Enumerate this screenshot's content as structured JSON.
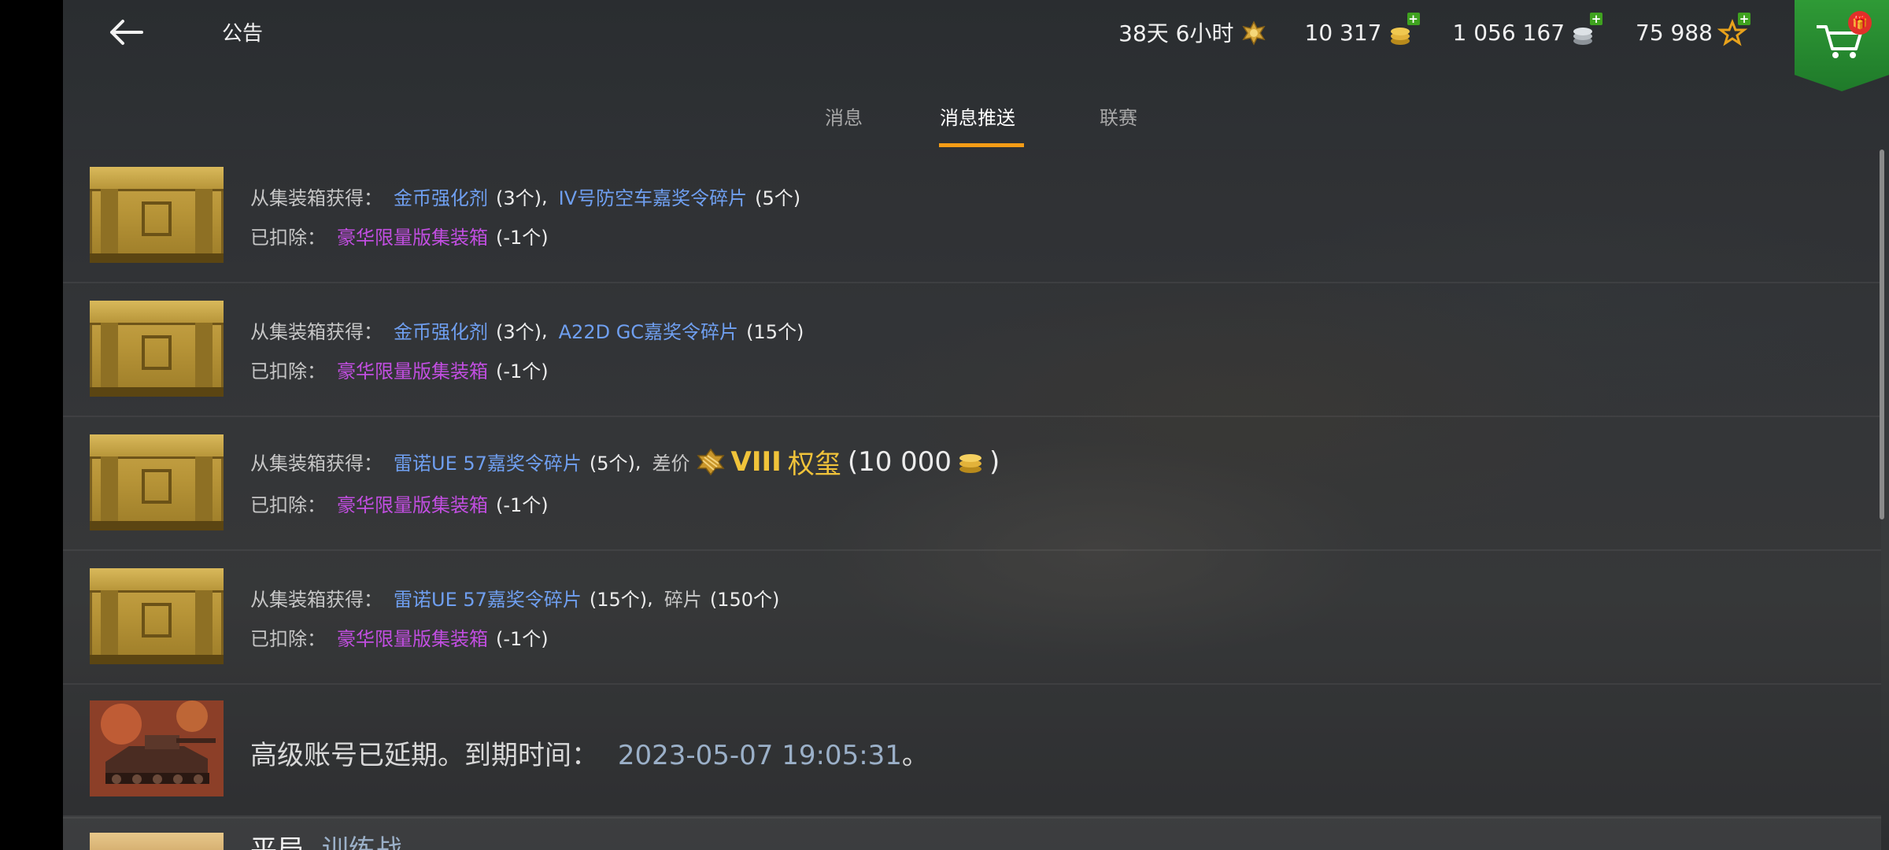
{
  "header": {
    "title": "公告",
    "back_icon": "back-arrow-icon",
    "resources": [
      {
        "value": "38天 6小时",
        "icon": "premium-account-icon",
        "plus": false
      },
      {
        "value": "10 317",
        "icon": "gold-coins-icon",
        "plus": true
      },
      {
        "value": "1 056 167",
        "icon": "silver-credits-icon",
        "plus": true
      },
      {
        "value": "75 988",
        "icon": "free-xp-star-icon",
        "plus": true
      }
    ],
    "shop_icon": "shop-cart-icon"
  },
  "tabs": [
    {
      "label": "消息",
      "active": false
    },
    {
      "label": "消息推送",
      "active": true
    },
    {
      "label": "联赛",
      "active": false
    }
  ],
  "messages": [
    {
      "obtained_label": "从集装箱获得：",
      "items": [
        {
          "name": "金币强化剂",
          "qty": "(3个)",
          "sep": ","
        },
        {
          "name": "IV号防空车嘉奖令碎片",
          "qty": "(5个)",
          "sep": ""
        }
      ],
      "deducted_label": "已扣除：",
      "deducted_name": "豪华限量版集装箱",
      "deducted_qty": "(-1个)"
    },
    {
      "obtained_label": "从集装箱获得：",
      "items": [
        {
          "name": "金币强化剂",
          "qty": "(3个)",
          "sep": ","
        },
        {
          "name": "A22D GC嘉奖令碎片",
          "qty": "(15个)",
          "sep": ""
        }
      ],
      "deducted_label": "已扣除：",
      "deducted_name": "豪华限量版集装箱",
      "deducted_qty": "(-1个)"
    },
    {
      "obtained_label": "从集装箱获得：",
      "items": [
        {
          "name": "雷诺UE 57嘉奖令碎片",
          "qty": "(5个)",
          "sep": ","
        }
      ],
      "diff_label": "差价",
      "tier": "VIII",
      "tank_name": "权玺",
      "diff_open": "(10 000",
      "diff_close": ")",
      "deducted_label": "已扣除：",
      "deducted_name": "豪华限量版集装箱",
      "deducted_qty": "(-1个)"
    },
    {
      "obtained_label": "从集装箱获得：",
      "items": [
        {
          "name": "雷诺UE 57嘉奖令碎片",
          "qty": "(15个)",
          "sep": ","
        },
        {
          "name": "碎片",
          "qty": "(150个)",
          "sep": ""
        }
      ],
      "deducted_label": "已扣除：",
      "deducted_name": "豪华限量版集装箱",
      "deducted_qty": "(-1个)"
    }
  ],
  "premium_notice": {
    "text": "高级账号已延期。到期时间：",
    "date": "2023-05-07 19:05:31",
    "end": "。"
  },
  "partial_row": {
    "title": "平局",
    "subtitle": "训练战"
  },
  "colors": {
    "accent": "#f39c16",
    "item_blue": "#6f9ff0",
    "item_purple": "#c14ee0",
    "gold": "#f0c33a",
    "shop_green": "#2f9a36"
  }
}
